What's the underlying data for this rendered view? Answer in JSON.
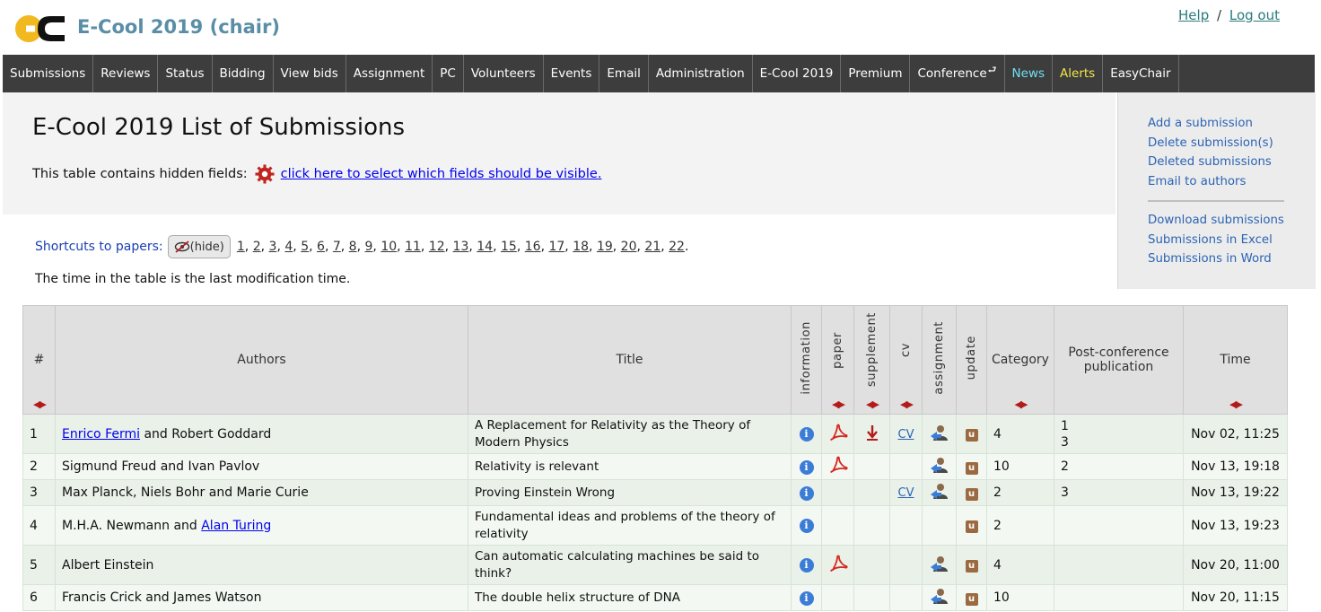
{
  "header": {
    "app_title": "E-Cool 2019 (chair)",
    "help_label": "Help",
    "separator": "/",
    "logout_label": "Log out",
    "logo_text": "EC"
  },
  "nav": [
    {
      "label": "Submissions"
    },
    {
      "label": "Reviews"
    },
    {
      "label": "Status"
    },
    {
      "label": "Bidding"
    },
    {
      "label": "View bids"
    },
    {
      "label": "Assignment"
    },
    {
      "label": "PC"
    },
    {
      "label": "Volunteers"
    },
    {
      "label": "Events"
    },
    {
      "label": "Email"
    },
    {
      "label": "Administration"
    },
    {
      "label": "E-Cool 2019"
    },
    {
      "label": "Premium"
    },
    {
      "label": "Conference"
    },
    {
      "label": "News"
    },
    {
      "label": "Alerts"
    },
    {
      "label": "EasyChair"
    }
  ],
  "colors": {
    "news": "#6fe0f2",
    "alerts": "#f3e64a",
    "nav_bg": "#3d3d3d",
    "title": "#5a8ea6"
  },
  "page": {
    "title": "E-Cool 2019 List of Submissions",
    "hidden_fields_text": "This table contains hidden fields:",
    "hidden_fields_link": "click here to select which fields should be visible.",
    "time_note": "The time in the table is the last modification time."
  },
  "side_menu": {
    "group1": [
      "Add a submission",
      "Delete submission(s)",
      "Deleted submissions",
      "Email to authors"
    ],
    "group2": [
      "Download submissions",
      "Submissions in Excel",
      "Submissions in Word"
    ]
  },
  "shortcuts": {
    "label": "Shortcuts to papers:",
    "hide_label": "(hide)",
    "numbers": [
      "1",
      "2",
      "3",
      "4",
      "5",
      "6",
      "7",
      "8",
      "9",
      "10",
      "11",
      "12",
      "13",
      "14",
      "15",
      "16",
      "17",
      "18",
      "19",
      "20",
      "21",
      "22"
    ]
  },
  "table": {
    "headers": {
      "num": "#",
      "authors": "Authors",
      "title": "Title",
      "information": "information",
      "paper": "paper",
      "supplement": "supplement",
      "cv": "cv",
      "assignment": "assignment",
      "update": "update",
      "category": "Category",
      "post_conf": "Post-conference publication",
      "time": "Time"
    },
    "cv_label": "CV",
    "rows": [
      {
        "num": "1",
        "author_link": "Enrico Fermi",
        "author_rest": " and Robert Goddard",
        "title": "A Replacement for Relativity as the Theory of Modern Physics",
        "paper": true,
        "supplement": true,
        "cv": true,
        "assignment": true,
        "category": "4",
        "post_conf": "1\n3",
        "time": "Nov 02, 11:25"
      },
      {
        "num": "2",
        "author_link": "",
        "author_rest": "Sigmund Freud and Ivan Pavlov",
        "title": "Relativity is relevant",
        "paper": true,
        "supplement": false,
        "cv": false,
        "assignment": true,
        "category": "10",
        "post_conf": "2",
        "time": "Nov 13, 19:18"
      },
      {
        "num": "3",
        "author_link": "",
        "author_rest": "Max Planck, Niels Bohr and Marie Curie",
        "title": "Proving Einstein Wrong",
        "paper": false,
        "supplement": false,
        "cv": true,
        "assignment": true,
        "category": "2",
        "post_conf": "3",
        "time": "Nov 13, 19:22"
      },
      {
        "num": "4",
        "author_prefix": "M.H.A. Newmann and ",
        "author_link": "Alan Turing",
        "author_rest": "",
        "title": "Fundamental ideas and problems of the theory of relativity",
        "paper": false,
        "supplement": false,
        "cv": false,
        "assignment": false,
        "category": "2",
        "post_conf": "",
        "time": "Nov 13, 19:23"
      },
      {
        "num": "5",
        "author_link": "",
        "author_rest": "Albert Einstein",
        "title": "Can automatic calculating machines be said to think?",
        "paper": true,
        "supplement": false,
        "cv": false,
        "assignment": true,
        "category": "4",
        "post_conf": "",
        "time": "Nov 20, 11:00"
      },
      {
        "num": "6",
        "author_link": "",
        "author_rest": "Francis Crick and James Watson",
        "title": "The double helix structure of DNA",
        "paper": false,
        "supplement": false,
        "cv": false,
        "assignment": true,
        "category": "10",
        "post_conf": "",
        "time": "Nov 20, 11:15"
      }
    ]
  }
}
